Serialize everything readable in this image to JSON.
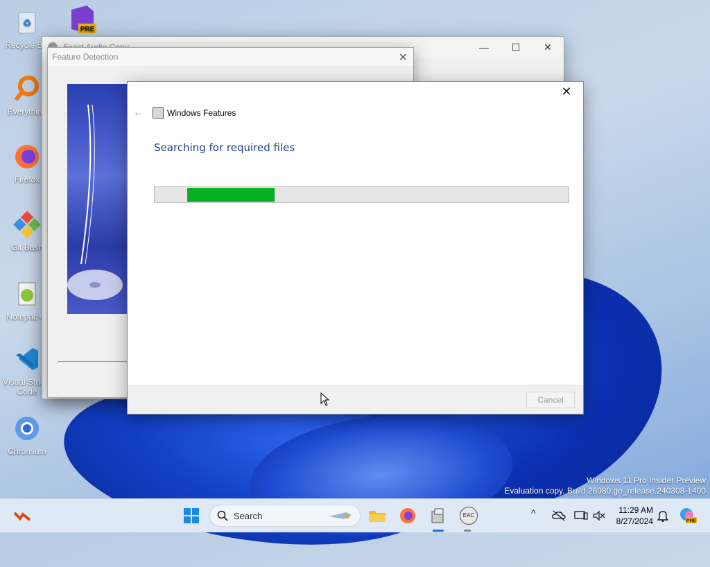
{
  "desktop": {
    "icons": [
      {
        "label": "Recycle Bin",
        "icon": "recycle-bin-icon"
      },
      {
        "label": "Everything",
        "icon": "everything-search-icon"
      },
      {
        "label": "Firefox",
        "icon": "firefox-icon"
      },
      {
        "label": "Git Bash",
        "icon": "git-bash-icon"
      },
      {
        "label": "Notepad++",
        "icon": "notepad-plus-plus-icon"
      },
      {
        "label": "Visual Studio Code",
        "icon": "vscode-icon"
      },
      {
        "label": "Chromium",
        "icon": "chromium-icon"
      },
      {
        "label": "PRE",
        "icon": "visual-studio-preview-icon"
      }
    ],
    "watermark": {
      "line1": "Windows 11 Pro Insider Preview",
      "line2": "Evaluation copy. Build 26080.ge_release.240308-1400"
    }
  },
  "eac_window": {
    "title": "Exact Audio Copy",
    "controls": {
      "minimize": "—",
      "maximize": "☐",
      "close": "✕"
    }
  },
  "feature_detection": {
    "title": "Feature Detection",
    "close": "✕"
  },
  "windows_features": {
    "close": "✕",
    "back": "←",
    "title": "Windows Features",
    "heading": "Searching for required files",
    "progress": {
      "start": 0.078,
      "end": 0.29
    },
    "cancel_label": "Cancel"
  },
  "taskbar": {
    "search_placeholder": "Search",
    "time": "11:29 AM",
    "date": "8/27/2024",
    "apps": [
      "start-icon",
      "search-icon",
      "file-explorer-icon",
      "firefox-icon",
      "app-icon",
      "eac-icon"
    ],
    "tray_up_arrow": "^",
    "eac_label": "EAC"
  },
  "colors": {
    "progress_fill": "#06b025",
    "heading": "#1e3f8a"
  }
}
